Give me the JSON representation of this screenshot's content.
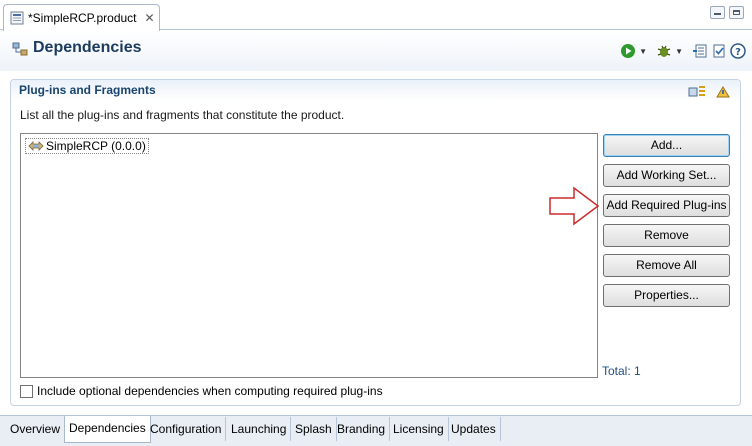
{
  "editor_tab": {
    "title": "*SimpleRCP.product",
    "close_glyph": "✕"
  },
  "header": {
    "title": "Dependencies"
  },
  "section": {
    "title": "Plug-ins and Fragments",
    "description": "List all the plug-ins and fragments that constitute the product."
  },
  "plugins": [
    {
      "label": "SimpleRCP (0.0.0)"
    }
  ],
  "buttons": {
    "add": "Add...",
    "add_working_set": "Add Working Set...",
    "add_required": "Add Required Plug-ins",
    "remove": "Remove",
    "remove_all": "Remove All",
    "properties": "Properties..."
  },
  "total": "Total: 1",
  "optional_deps": {
    "label": "Include optional dependencies when computing required plug-ins",
    "checked": false
  },
  "bottom_tabs": [
    "Overview",
    "Dependencies",
    "Configuration",
    "Launching",
    "Splash",
    "Branding",
    "Licensing",
    "Updates"
  ],
  "active_tab": "Dependencies",
  "icons": {
    "editor_tab": "product-file-icon",
    "header": "dependencies-icon",
    "toolbar": [
      "run-icon",
      "debug-icon",
      "export-icon",
      "validate-icon",
      "help-icon"
    ],
    "section_tools": [
      "sort-icon",
      "collapse-icon"
    ],
    "plugin": "plugin-icon",
    "arrow": "red-arrow-callout"
  },
  "colors": {
    "title": "#1c3a5e",
    "section_title": "#19446e",
    "arrow": "#cc2b2b",
    "run": "#2e9a2e",
    "link": "#1f4f80"
  }
}
